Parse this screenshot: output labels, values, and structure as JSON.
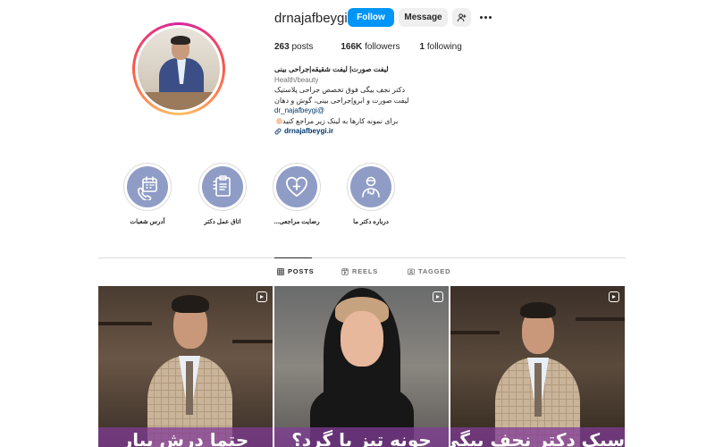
{
  "profile": {
    "username": "drnajafbeygi",
    "follow_label": "Follow",
    "message_label": "Message",
    "stats": {
      "posts_count": "263",
      "posts_label": "posts",
      "followers_count": "166K",
      "followers_label": "followers",
      "following_count": "1",
      "following_label": "following"
    },
    "bio": {
      "full_name": "لیفت صورت| لیفت شقیقه|جراحی بینی",
      "category": "Health/beauty",
      "line1": "دکتر نجف بیگی فوق تخصص جراحی پلاستیک",
      "line2": "لیفت صورت و ابرو|جراحی بینی، گوش و دهان",
      "mention": "dr_najafbeygi@",
      "line3": "برای نمونه کارها به لینک زیر مراجع کنید",
      "link": "drnajafbeygi.ir"
    }
  },
  "highlights": [
    {
      "label": "آدرس شعبات",
      "icon": "phone-calendar-icon"
    },
    {
      "label": "اتاق عمل دکتر",
      "icon": "clipboard-document-icon"
    },
    {
      "label": "رضایت مراجعی...",
      "icon": "heart-plus-icon"
    },
    {
      "label": "درباره دکتر ما",
      "icon": "doctor-icon"
    }
  ],
  "tabs": {
    "posts": "POSTS",
    "reels": "REELS",
    "tagged": "TAGGED"
  },
  "posts": [
    {
      "caption": "حتما درش بیار"
    },
    {
      "caption": "چونه تیز یا گرد؟"
    },
    {
      "caption": "سبک دکتر نجف بیگی"
    }
  ],
  "colors": {
    "follow_button": "#0095f6",
    "highlight_fill": "#8f9cc6",
    "caption_band": "#803c96"
  }
}
